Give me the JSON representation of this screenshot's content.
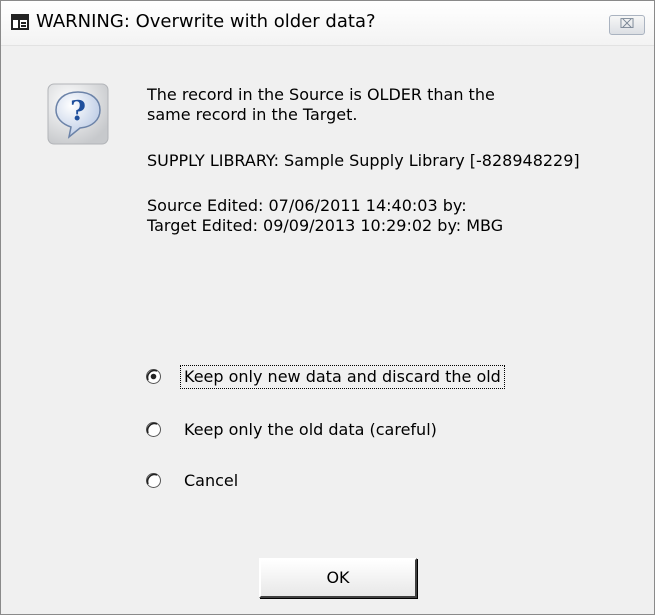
{
  "window": {
    "title": "WARNING: Overwrite with older data?",
    "close_glyph": "⌧"
  },
  "message": {
    "line1": "The record in the Source is OLDER than the",
    "line2": "same record in the Target.",
    "library_line": "SUPPLY LIBRARY: Sample Supply Library [-828948229]",
    "source_edited": "Source Edited: 07/06/2011 14:40:03   by:",
    "target_edited": "Target Edited: 09/09/2013 10:29:02   by: MBG"
  },
  "options": [
    {
      "label": "Keep only new data and discard the old",
      "selected": true
    },
    {
      "label": "Keep only the old data (careful)",
      "selected": false
    },
    {
      "label": "Cancel",
      "selected": false
    }
  ],
  "buttons": {
    "ok_label": "OK"
  },
  "icons": {
    "title": "form-icon",
    "message": "question-icon",
    "close": "close-icon"
  },
  "colors": {
    "dialog_bg": "#f0f0f0",
    "question_bubble": "#3a6fbf"
  }
}
